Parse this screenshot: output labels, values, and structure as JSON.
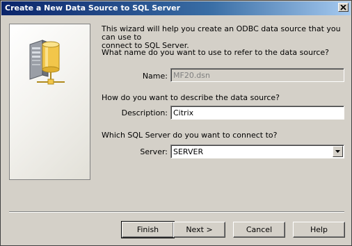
{
  "window": {
    "title": "Create a New Data Source to SQL Server",
    "close_icon": "close-icon"
  },
  "art": {
    "icon": "server-database-network-icon"
  },
  "intro_text": "This wizard will help you create an ODBC data source that you can use to\nconnect to SQL Server.",
  "name_section": {
    "question": "What name do you want to use to refer to the data source?",
    "label": "Name:",
    "value": "MF20.dsn",
    "disabled": true
  },
  "description_section": {
    "question": "How do you want to describe the data source?",
    "label": "Description:",
    "value": "Citrix"
  },
  "server_section": {
    "question": "Which SQL Server do you want to connect to?",
    "label": "Server:",
    "value": "SERVER",
    "dropdown_icon": "chevron-down-icon"
  },
  "buttons": {
    "finish": "Finish",
    "next": "Next >",
    "cancel": "Cancel",
    "help": "Help"
  },
  "colors": {
    "title_start": "#0a246a",
    "title_end": "#a6caf0",
    "face": "#d4d0c8"
  }
}
